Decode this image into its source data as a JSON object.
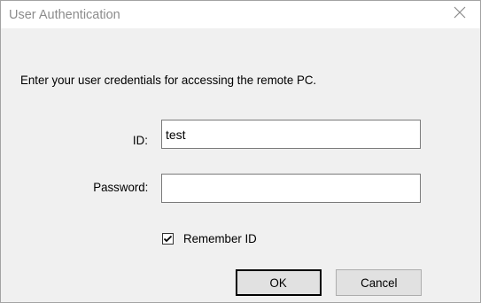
{
  "window": {
    "title": "User Authentication"
  },
  "icons": {
    "close": "close-icon",
    "check": "checkmark-icon"
  },
  "dialog": {
    "instruction": "Enter your user credentials for accessing the remote PC.",
    "id_label": "ID:",
    "id_value": "test",
    "password_label": "Password:",
    "password_value": "",
    "remember_label": "Remember ID",
    "remember_checked": true,
    "ok_label": "OK",
    "cancel_label": "Cancel"
  },
  "colors": {
    "title_text": "#8c8c8c",
    "dialog_bg": "#f0f0f0",
    "button_bg": "#e1e1e1"
  }
}
